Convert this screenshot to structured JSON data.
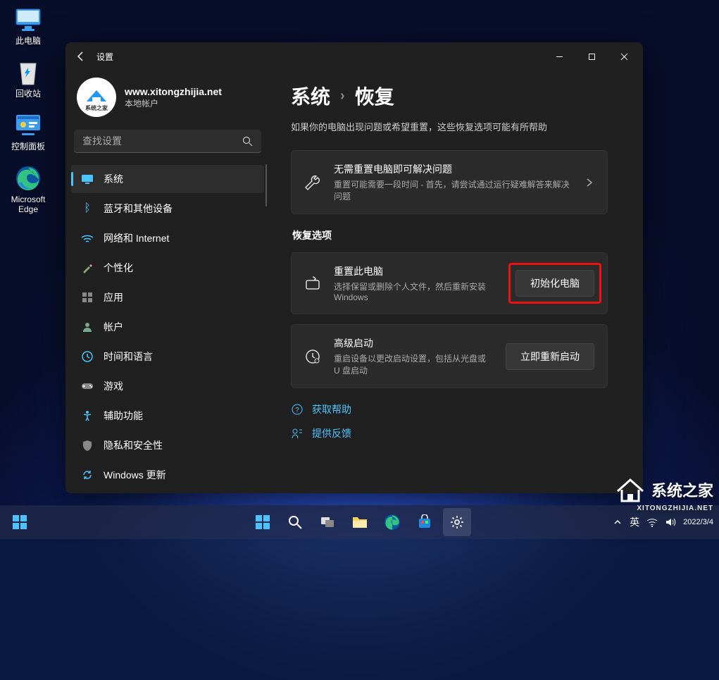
{
  "desktop_icons": [
    {
      "id": "this-pc",
      "label": "此电脑"
    },
    {
      "id": "recycle",
      "label": "回收站"
    },
    {
      "id": "control-panel",
      "label": "控制面板"
    },
    {
      "id": "edge",
      "label": "Microsoft Edge"
    }
  ],
  "window": {
    "app_name": "设置",
    "user": {
      "name": "www.xitongzhijia.net",
      "account_type": "本地帐户"
    },
    "search_placeholder": "查找设置",
    "nav": [
      {
        "id": "system",
        "label": "系统",
        "active": true
      },
      {
        "id": "bluetooth",
        "label": "蓝牙和其他设备"
      },
      {
        "id": "network",
        "label": "网络和 Internet"
      },
      {
        "id": "personalize",
        "label": "个性化"
      },
      {
        "id": "apps",
        "label": "应用"
      },
      {
        "id": "accounts",
        "label": "帐户"
      },
      {
        "id": "time",
        "label": "时间和语言"
      },
      {
        "id": "gaming",
        "label": "游戏"
      },
      {
        "id": "accessibility",
        "label": "辅助功能"
      },
      {
        "id": "privacy",
        "label": "隐私和安全性"
      },
      {
        "id": "update",
        "label": "Windows 更新"
      }
    ],
    "breadcrumb": {
      "parent": "系统",
      "current": "恢复"
    },
    "subheading": "如果你的电脑出现问题或希望重置，这些恢复选项可能有所帮助",
    "troubleshoot": {
      "title": "无需重置电脑即可解决问题",
      "desc": "重置可能需要一段时间 - 首先，请尝试通过运行疑难解答来解决问题"
    },
    "recovery_section": "恢复选项",
    "reset": {
      "title": "重置此电脑",
      "desc": "选择保留或删除个人文件，然后重新安装 Windows",
      "button": "初始化电脑"
    },
    "advanced": {
      "title": "高级启动",
      "desc": "重启设备以更改启动设置，包括从光盘或 U 盘启动",
      "button": "立即重新启动"
    },
    "help_link": "获取帮助",
    "feedback_link": "提供反馈"
  },
  "tray": {
    "datetime": "2022/3/4"
  },
  "watermark": {
    "brand": "系统之家",
    "url": "XITONGZHIJIA.NET"
  }
}
